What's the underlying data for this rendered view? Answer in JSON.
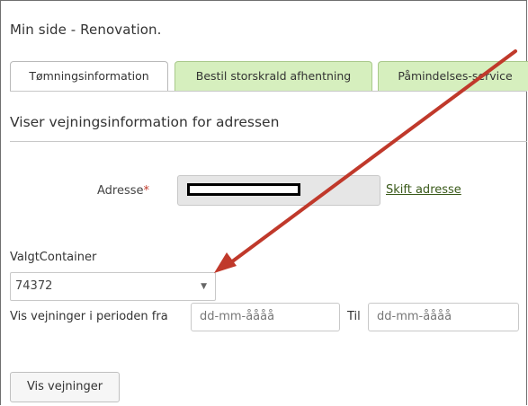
{
  "page": {
    "title": "Min side - Renovation."
  },
  "tabs": [
    {
      "label": "Tømningsinformation"
    },
    {
      "label": "Bestil storskrald afhentning"
    },
    {
      "label": "Påmindelses-service"
    }
  ],
  "section": {
    "subtitle": "Viser vejningsinformation for adressen"
  },
  "address": {
    "label": "Adresse",
    "required_mark": "*",
    "change_link": "Skift adresse"
  },
  "container": {
    "label": "ValgtContainer",
    "selected": "74372"
  },
  "period": {
    "label": "Vis vejninger i perioden fra",
    "from_placeholder": "dd-mm-åååå",
    "to_label": "Til",
    "to_placeholder": "dd-mm-åååå"
  },
  "actions": {
    "submit_label": "Vis vejninger"
  },
  "colors": {
    "tab_green": "#d6efbe",
    "annotation_arrow": "#c0392b",
    "link": "#3a5a1a"
  }
}
